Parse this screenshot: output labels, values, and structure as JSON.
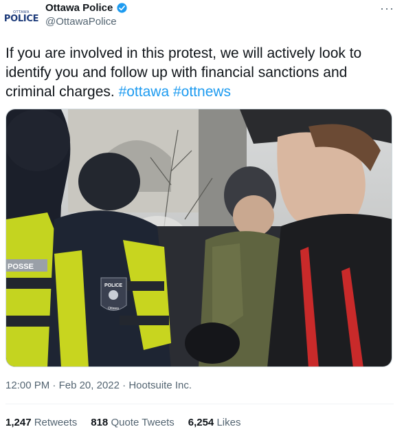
{
  "account": {
    "avatar_small_text": "OTTAWA",
    "avatar_logo_text": "POLICE",
    "name": "Ottawa Police",
    "handle": "@OttawaPolice"
  },
  "tweet": {
    "text": "If you are involved in this protest, we will actively look to identify you and follow up with financial sanctions and criminal charges.",
    "hashtags": [
      "#ottawa",
      "#ottnews"
    ],
    "media_badge_text": "POLICE",
    "media_badge_sub": "Ottawa",
    "vest_text": "POSSE"
  },
  "meta": {
    "time": "12:00 PM",
    "sep1": "·",
    "date": "Feb 20, 2022",
    "sep2": "·",
    "source": "Hootsuite Inc."
  },
  "stats": {
    "retweets_count": "1,247",
    "retweets_label": "Retweets",
    "quotes_count": "818",
    "quotes_label": "Quote Tweets",
    "likes_count": "6,254",
    "likes_label": "Likes"
  },
  "colors": {
    "link": "#1d9bf0",
    "secondary_text": "#536471",
    "verified": "#1d9bf0"
  }
}
